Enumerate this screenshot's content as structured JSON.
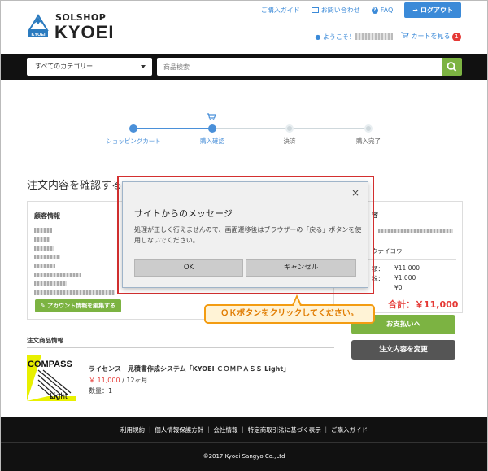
{
  "header": {
    "logo_top": "SOLSHOP",
    "logo_main": "KYOEI",
    "logo_badge": "KYOEI",
    "links": [
      "ご購入ガイド",
      "お問い合わせ",
      "FAQ"
    ],
    "logout": "ログアウト",
    "welcome": "ようこそ！",
    "cart_label": "カートを見る",
    "cart_count": "1"
  },
  "search": {
    "category": "すべてのカテゴリー",
    "placeholder": "商品検索"
  },
  "steps": [
    {
      "label": "ショッピングカート",
      "state": "done"
    },
    {
      "label": "購入確認",
      "state": "active"
    },
    {
      "label": "決済",
      "state": "todo"
    },
    {
      "label": "購入完了",
      "state": "todo"
    }
  ],
  "page": {
    "title": "注文内容を確認する",
    "customer_title": "顧客情報",
    "edit_button": "アカウント情報を編集する",
    "order_title": "容",
    "order_row2": "ウナイヨウ",
    "order_lines": [
      {
        "label": "額：",
        "value": "¥11,000"
      },
      {
        "label": "税：",
        "value": "¥1,000"
      },
      {
        "label": "：",
        "value": "¥0"
      }
    ],
    "total": "合計：￥11,000",
    "pay_button": "お支払いへ",
    "change_button": "注文内容を変更"
  },
  "items": {
    "title": "注文商品情報",
    "product_name": "ライセンス　見積書作成システム「KYOEI ＣＯＭＰＡＳＳ Light」",
    "price": "￥ 11,000",
    "price_suffix": " / 12ヶ月",
    "quantity": "数量：1",
    "image_text_top": "COMPASS",
    "image_text_bottom": "Light"
  },
  "footer": {
    "links": "利用規約 ｜ 個人情報保護方針 ｜ 会社情報 ｜ 特定商取引法に基づく表示 ｜ ご購入ガイド",
    "copyright": "©2017 Kyoei Sangyo Co.,Ltd"
  },
  "dialog": {
    "close": "×",
    "title": "サイトからのメッセージ",
    "message": "処理が正しく行えませんので、画面遷移後はブラウザーの「戻る」ボタンを使用しないでください。",
    "ok": "OK",
    "cancel": "キャンセル"
  },
  "callout": "ＯＫボタンをクリックしてください。",
  "colors": {
    "accent_blue": "#3b8ad8",
    "accent_green": "#7cb342",
    "alert_red": "#e53935",
    "callout_orange": "#f39c12"
  }
}
